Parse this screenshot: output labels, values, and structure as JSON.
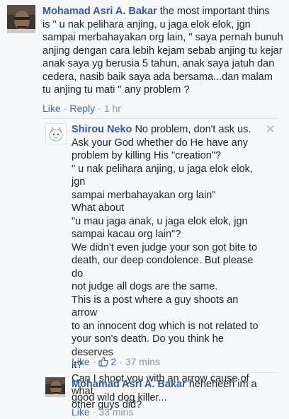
{
  "comment1": {
    "author": "Mohamad Asri A. Bakar",
    "lines": [
      "the most important thins",
      "is \" u nak pelihara anjing, u jaga elok elok, jgn",
      "sampai merbahayakan org lain, \" saya pernah bunuh",
      "anjing dengan cara lebih kejam sebab anjing tu kejar",
      "anak saya yg berusia 5 tahun, anak saya jatuh dan",
      "cedera, nasib baik saya ada bersama...dan malam",
      "tu anjing tu mati \" any problem ?"
    ],
    "like_label": "Like",
    "reply_label": "Reply",
    "time": "1 hr"
  },
  "reply1": {
    "author": "Shirou Neko",
    "lines": [
      "No problem, don't ask us.",
      "Ask your God whether do He have any",
      "problem by killing His \"creation\"?",
      "\" u nak pelihara anjing, u jaga elok elok, jgn",
      "sampai merbahayakan org lain\"",
      "What about",
      "\"u mau jaga anak, u jaga elok elok, jgn",
      "sampai kacau org lain\"?",
      "We didn't even judge your son got bite to",
      "death, our deep condolence. But please do",
      "not judge all dogs are the same.",
      "This is a post where a guy shoots an arrow",
      "to an innocent dog which is not related to",
      "your son's death. Do you think he deserves",
      "it?",
      "Can I shoot you with an arrow cause of what",
      "other guys did?"
    ],
    "like_label": "Like",
    "like_count": "2",
    "time": "37 mins",
    "close_glyph": "✕"
  },
  "reply2": {
    "author": "Mohamad Asri A. Bakar",
    "lines": [
      "heheheeh im a",
      "good wild dog killer..."
    ],
    "like_label": "Like",
    "time": "33 mins"
  },
  "colors": {
    "name": "#365899",
    "link": "#4267b2",
    "meta": "#90949c",
    "background": "#f6f7f9"
  }
}
